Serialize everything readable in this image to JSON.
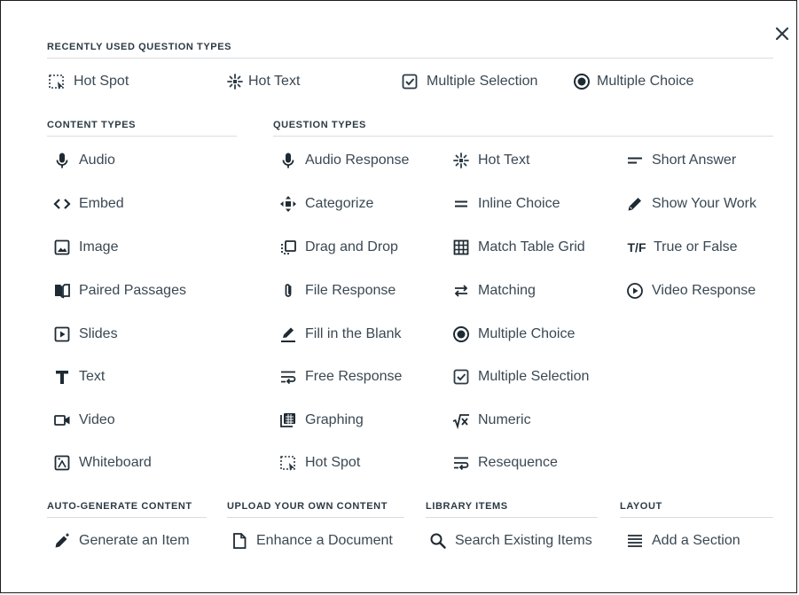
{
  "close": {
    "icon": "close-icon"
  },
  "recent": {
    "header": "RECENTLY USED QUESTION TYPES",
    "items": [
      {
        "label": "Hot Spot",
        "icon": "hotspot-icon"
      },
      {
        "label": "Hot Text",
        "icon": "hottext-icon"
      },
      {
        "label": "Multiple Selection",
        "icon": "checkbox-icon"
      },
      {
        "label": "Multiple Choice",
        "icon": "radio-icon"
      }
    ]
  },
  "content_types": {
    "header": "CONTENT TYPES",
    "items": [
      {
        "label": "Audio",
        "icon": "microphone-icon"
      },
      {
        "label": "Embed",
        "icon": "code-icon"
      },
      {
        "label": "Image",
        "icon": "image-icon"
      },
      {
        "label": "Paired Passages",
        "icon": "paired-passages-icon"
      },
      {
        "label": "Slides",
        "icon": "slides-icon"
      },
      {
        "label": "Text",
        "icon": "text-icon"
      },
      {
        "label": "Video",
        "icon": "video-icon"
      },
      {
        "label": "Whiteboard",
        "icon": "whiteboard-icon"
      }
    ]
  },
  "question_types": {
    "header": "QUESTION TYPES",
    "col1": [
      {
        "label": "Audio Response",
        "icon": "microphone-icon"
      },
      {
        "label": "Categorize",
        "icon": "move-arrows-icon"
      },
      {
        "label": "Drag and Drop",
        "icon": "drag-drop-icon"
      },
      {
        "label": "File Response",
        "icon": "paperclip-icon"
      },
      {
        "label": "Fill in the Blank",
        "icon": "pencil-underline-icon"
      },
      {
        "label": "Free Response",
        "icon": "text-wrap-icon"
      },
      {
        "label": "Graphing",
        "icon": "graphing-icon"
      },
      {
        "label": "Hot Spot",
        "icon": "hotspot-icon"
      }
    ],
    "col2": [
      {
        "label": "Hot Text",
        "icon": "hottext-icon"
      },
      {
        "label": "Inline Choice",
        "icon": "equals-icon"
      },
      {
        "label": "Match Table Grid",
        "icon": "grid-icon"
      },
      {
        "label": "Matching",
        "icon": "swap-arrows-icon"
      },
      {
        "label": "Multiple Choice",
        "icon": "radio-icon"
      },
      {
        "label": "Multiple Selection",
        "icon": "checkbox-icon"
      },
      {
        "label": "Numeric",
        "icon": "sqrt-icon"
      },
      {
        "label": "Resequence",
        "icon": "text-wrap-icon"
      }
    ],
    "col3": [
      {
        "label": "Short Answer",
        "icon": "short-line-icon"
      },
      {
        "label": "Show Your Work",
        "icon": "pencil-icon"
      },
      {
        "label": "True or False",
        "icon": "true-false-icon",
        "icon_text": "T/F"
      },
      {
        "label": "Video Response",
        "icon": "play-circle-icon"
      }
    ]
  },
  "auto_generate": {
    "header": "AUTO-GENERATE CONTENT",
    "item": {
      "label": "Generate an Item",
      "icon": "magic-wand-icon"
    }
  },
  "upload": {
    "header": "UPLOAD YOUR OWN CONTENT",
    "item": {
      "label": "Enhance a Document",
      "icon": "document-icon"
    }
  },
  "library": {
    "header": "LIBRARY ITEMS",
    "item": {
      "label": "Search Existing Items",
      "icon": "search-icon"
    }
  },
  "layout": {
    "header": "LAYOUT",
    "item": {
      "label": "Add a Section",
      "icon": "section-lines-icon"
    }
  }
}
